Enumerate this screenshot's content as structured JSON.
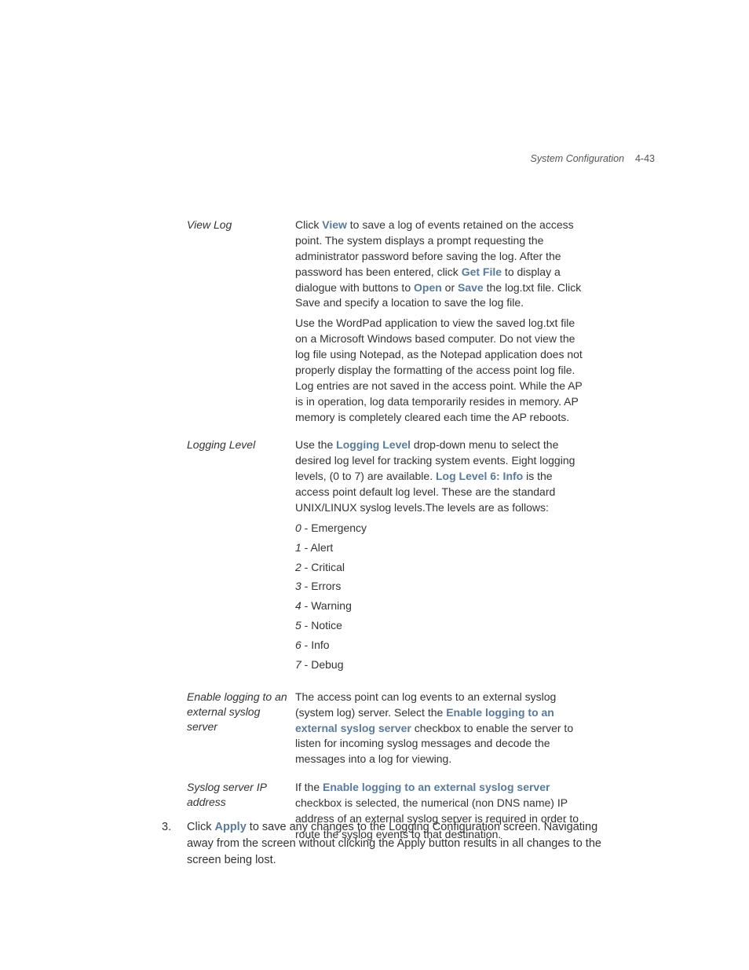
{
  "header": {
    "section_title": "System Configuration",
    "page_number": "4-43"
  },
  "rows": {
    "view_log": {
      "term": "View Log",
      "p1_a": "Click ",
      "p1_view": "View",
      "p1_b": " to save a log of events retained on the access point. The system displays a prompt requesting the administrator password before saving the log. After the password has been entered, click ",
      "p1_getfile": "Get File",
      "p1_c": " to display a dialogue with buttons to ",
      "p1_open": "Open",
      "p1_d": " or ",
      "p1_save": "Save",
      "p1_e": " the log.txt file. Click Save and specify a location to save the log file.",
      "p2": "Use the WordPad application to view the saved log.txt file on a Microsoft Windows based computer. Do not view the log file using Notepad, as the Notepad application does not properly display the formatting of the access point log file. Log entries are not saved in the access point. While the AP is in operation, log data temporarily resides in memory. AP memory is completely cleared each time the AP reboots."
    },
    "logging_level": {
      "term": "Logging Level",
      "p1_a": "Use the ",
      "p1_ll": "Logging Level",
      "p1_b": " drop-down menu to select the desired log level for tracking system events. Eight logging levels, (0 to 7) are available. ",
      "p1_ll6": "Log Level 6: Info",
      "p1_c": " is the access point default log level. These are the standard UNIX/LINUX syslog levels.The levels are as follows:",
      "levels": [
        {
          "num": "0",
          "label": " - Emergency"
        },
        {
          "num": "1",
          "label": " - Alert"
        },
        {
          "num": "2",
          "label": " - Critical"
        },
        {
          "num": "3",
          "label": " - Errors"
        },
        {
          "num": "4",
          "label": " - Warning"
        },
        {
          "num": "5",
          "label": " - Notice"
        },
        {
          "num": "6",
          "label": " - Info"
        },
        {
          "num": "7",
          "label": " - Debug"
        }
      ]
    },
    "enable_logging": {
      "term": "Enable logging to an external syslog server",
      "p1_a": "The access point can log events to an external syslog (system log) server. Select the ",
      "p1_link": "Enable logging to an external syslog server",
      "p1_b": " checkbox to enable the server to listen for incoming syslog messages and decode the messages into a log for viewing."
    },
    "syslog_ip": {
      "term": "Syslog server IP address",
      "p1_a": "If the ",
      "p1_link": "Enable logging to an external syslog server",
      "p1_b": " checkbox is selected, the numerical (non DNS name) IP address of an external syslog server is required in order to route the syslog events to that destination."
    }
  },
  "step3": {
    "num": "3.",
    "a": "Click ",
    "apply": "Apply",
    "b": " to save any changes to the Logging Configuration screen. Navigating away from the screen without clicking the Apply button results in all changes to the screen being lost."
  }
}
